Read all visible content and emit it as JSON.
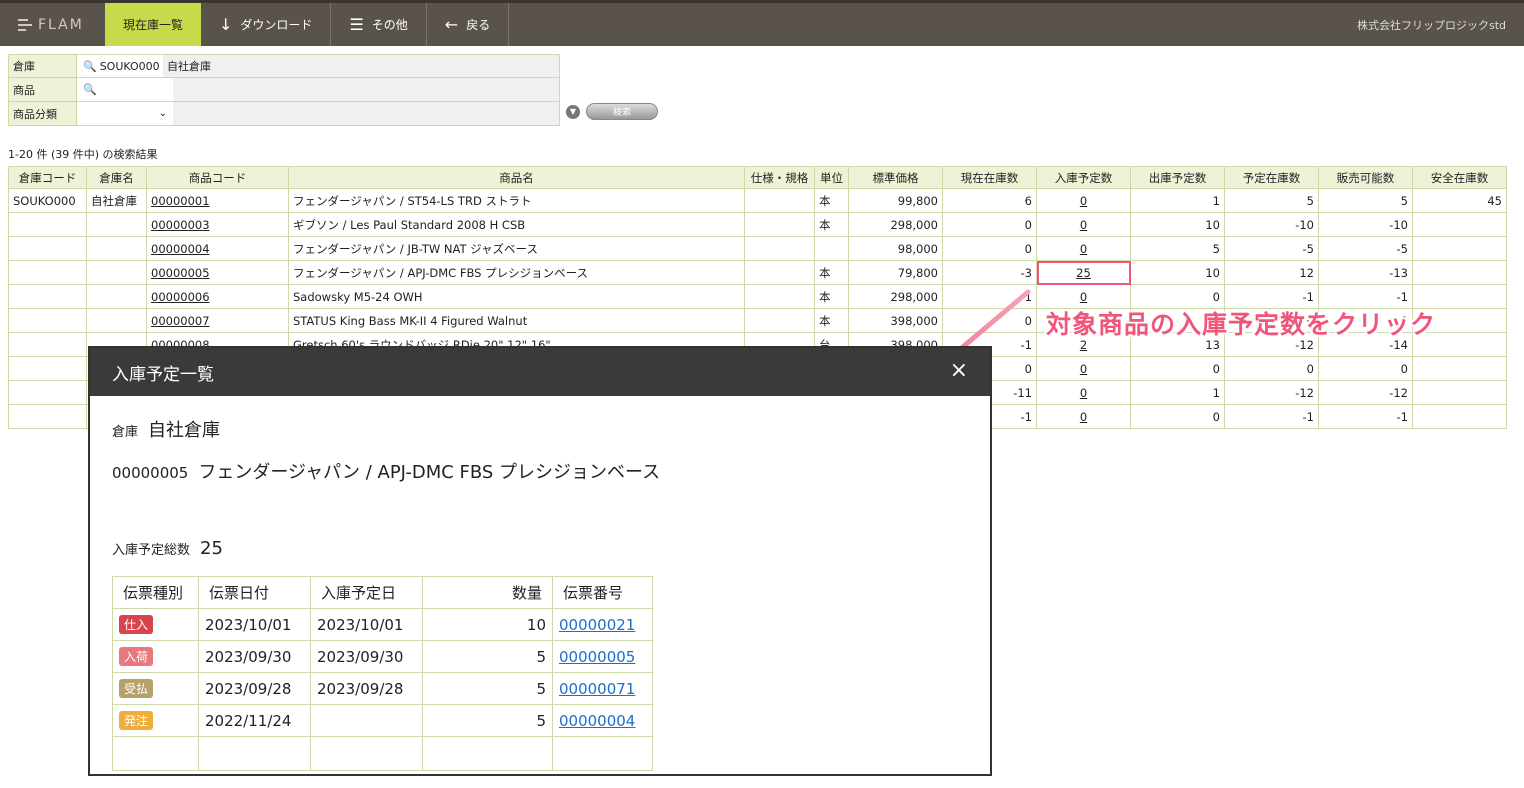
{
  "topbar": {
    "logo": "FLAM",
    "buttons": [
      {
        "label": "現在庫一覧",
        "icon": ""
      },
      {
        "label": "ダウンロード",
        "icon": "↓"
      },
      {
        "label": "その他",
        "icon": "☰"
      },
      {
        "label": "戻る",
        "icon": "←"
      }
    ],
    "company": "株式会社フリップロジックstd"
  },
  "search": {
    "warehouse_label": "倉庫",
    "warehouse_code": "SOUKO000",
    "warehouse_name": "自社倉庫",
    "product_label": "商品",
    "category_label": "商品分類",
    "search_button": "検索"
  },
  "result_count": "1-20 件 (39 件中) の検索結果",
  "table": {
    "headers": [
      "倉庫コード",
      "倉庫名",
      "商品コード",
      "商品名",
      "仕様・規格",
      "単位",
      "標準価格",
      "現在在庫数",
      "入庫予定数",
      "出庫予定数",
      "予定在庫数",
      "販売可能数",
      "安全在庫数"
    ],
    "rows": [
      [
        "SOUKO000",
        "自社倉庫",
        "00000001",
        "フェンダージャパン / ST54-LS TRD ストラト",
        "",
        "本",
        "99,800",
        "6",
        "0",
        "1",
        "5",
        "5",
        "45"
      ],
      [
        "",
        "",
        "00000003",
        "ギブソン / Les Paul Standard 2008 H CSB",
        "",
        "本",
        "298,000",
        "0",
        "0",
        "10",
        "-10",
        "-10",
        ""
      ],
      [
        "",
        "",
        "00000004",
        "フェンダージャパン / JB-TW NAT ジャズベース",
        "",
        "",
        "98,000",
        "0",
        "0",
        "5",
        "-5",
        "-5",
        ""
      ],
      [
        "",
        "",
        "00000005",
        "フェンダージャパン / APJ-DMC FBS プレシジョンベース",
        "",
        "本",
        "79,800",
        "-3",
        "25",
        "10",
        "12",
        "-13",
        ""
      ],
      [
        "",
        "",
        "00000006",
        "Sadowsky M5-24 OWH",
        "",
        "本",
        "298,000",
        "1",
        "0",
        "0",
        "-1",
        "-1",
        ""
      ],
      [
        "",
        "",
        "00000007",
        "STATUS King Bass MK-II 4 Figured Walnut",
        "",
        "本",
        "398,000",
        "0",
        "0",
        "0",
        "0",
        "0",
        ""
      ],
      [
        "",
        "",
        "00000008",
        "Gretsch 60's ラウンドバッジ RDie 20\" 12\" 16\"",
        "",
        "台",
        "398,000",
        "-1",
        "2",
        "13",
        "-12",
        "-14",
        ""
      ],
      [
        "",
        "",
        "",
        "",
        "",
        "",
        "",
        "0",
        "0",
        "0",
        "0",
        "0",
        ""
      ],
      [
        "",
        "",
        "",
        "",
        "",
        "",
        "",
        "-11",
        "0",
        "1",
        "-12",
        "-12",
        ""
      ],
      [
        "",
        "",
        "",
        "",
        "",
        "",
        "",
        "-1",
        "0",
        "0",
        "-1",
        "-1",
        ""
      ]
    ]
  },
  "annotation": "対象商品の入庫予定数をクリック",
  "modal": {
    "title": "入庫予定一覧",
    "close": "×",
    "warehouse_label": "倉庫",
    "warehouse_name": "自社倉庫",
    "product_code": "00000005",
    "product_name": "フェンダージャパン / APJ-DMC FBS プレシジョンベース",
    "total_label": "入庫予定総数",
    "total_value": "25",
    "headers": [
      "伝票種別",
      "伝票日付",
      "入庫予定日",
      "数量",
      "伝票番号"
    ],
    "rows": [
      {
        "type": "仕入",
        "color": "#d9434a",
        "date": "2023/10/01",
        "due": "2023/10/01",
        "qty": "10",
        "no": "00000021"
      },
      {
        "type": "入荷",
        "color": "#e9787e",
        "date": "2023/09/30",
        "due": "2023/09/30",
        "qty": "5",
        "no": "00000005"
      },
      {
        "type": "受払",
        "color": "#b8a06a",
        "date": "2023/09/28",
        "due": "2023/09/28",
        "qty": "5",
        "no": "00000071"
      },
      {
        "type": "発注",
        "color": "#f0ad3c",
        "date": "2022/11/24",
        "due": "",
        "qty": "5",
        "no": "00000004"
      }
    ]
  }
}
